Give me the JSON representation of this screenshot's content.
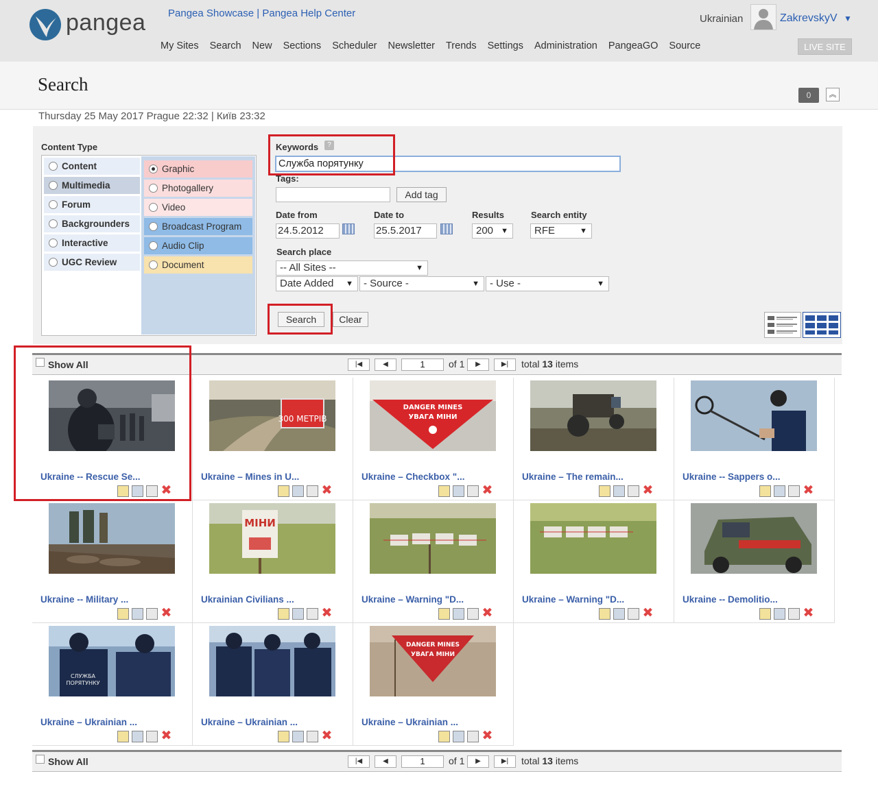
{
  "header": {
    "logo_text": "pangea",
    "top_links": [
      "Pangea Showcase",
      "Pangea Help Center"
    ],
    "top_links_separator": "|",
    "nav": [
      "My Sites",
      "Search",
      "New",
      "Sections",
      "Scheduler",
      "Newsletter",
      "Trends",
      "Settings",
      "Administration",
      "PangeaGO",
      "Source"
    ],
    "language": "Ukrainian",
    "username": "ZakrevskyV",
    "live_site": "LIVE SITE"
  },
  "page": {
    "title": "Search",
    "counter": "0",
    "datetime": "Thursday 25 May 2017 Prague 22:32 | Київ 23:32"
  },
  "search": {
    "content_type_label": "Content Type",
    "content_types_left": [
      {
        "label": "Content",
        "selected": false
      },
      {
        "label": "Multimedia",
        "selected": true
      },
      {
        "label": "Forum",
        "selected": false
      },
      {
        "label": "Backgrounders",
        "selected": false
      },
      {
        "label": "Interactive",
        "selected": false
      },
      {
        "label": "UGC Review",
        "selected": false
      }
    ],
    "content_types_right": [
      {
        "label": "Graphic",
        "checked": true,
        "color": "#f9cccc"
      },
      {
        "label": "Photogallery",
        "checked": false,
        "color": "#fbdddd"
      },
      {
        "label": "Video",
        "checked": false,
        "color": "#fde5e5"
      },
      {
        "label": "Broadcast Program",
        "checked": false,
        "color": "#8fbbe6"
      },
      {
        "label": "Audio Clip",
        "checked": false,
        "color": "#8fbbe6"
      },
      {
        "label": "Document",
        "checked": false,
        "color": "#f8e2ad"
      }
    ],
    "keywords_label": "Keywords",
    "keywords_help": "?",
    "keywords_value": "Служба порятунку",
    "tags_label": "Tags:",
    "tags_value": "",
    "add_tag": "Add tag",
    "date_from_label": "Date from",
    "date_from": "24.5.2012",
    "date_to_label": "Date to",
    "date_to": "25.5.2017",
    "results_label": "Results",
    "results_value": "200",
    "entity_label": "Search entity",
    "entity_value": "RFE",
    "place_label": "Search place",
    "place_value": "-- All Sites --",
    "sort_value": "Date Added",
    "source_value": "- Source -",
    "use_value": "- Use -",
    "search_button": "Search",
    "clear_button": "Clear"
  },
  "results": {
    "show_all": "Show All",
    "page": "1",
    "of_label": "of 1",
    "total_prefix": "total",
    "total_count": "13",
    "total_suffix": "items",
    "items": [
      {
        "title": "Ukraine -- Rescue Se...",
        "img": "rescue-night"
      },
      {
        "title": "Ukraine – Mines in U...",
        "img": "mines-road"
      },
      {
        "title": "Ukraine – Checkbox \"...",
        "img": "danger-mines"
      },
      {
        "title": "Ukraine – The remain...",
        "img": "tractor"
      },
      {
        "title": "Ukraine -- Sappers o...",
        "img": "sapper"
      },
      {
        "title": "Ukraine -- Military ...",
        "img": "military"
      },
      {
        "title": "Ukrainian Civilians ...",
        "img": "miny-sign"
      },
      {
        "title": "Ukraine – Warning \"D...",
        "img": "warning-field"
      },
      {
        "title": "Ukraine – Warning \"D...",
        "img": "warning-field2"
      },
      {
        "title": "Ukraine -- Demolitio...",
        "img": "jeep"
      },
      {
        "title": "Ukraine – Ukrainian ...",
        "img": "rescuers"
      },
      {
        "title": "Ukraine – Ukrainian ...",
        "img": "rescuers2"
      },
      {
        "title": "Ukraine – Ukrainian ...",
        "img": "danger-mines2"
      }
    ]
  }
}
